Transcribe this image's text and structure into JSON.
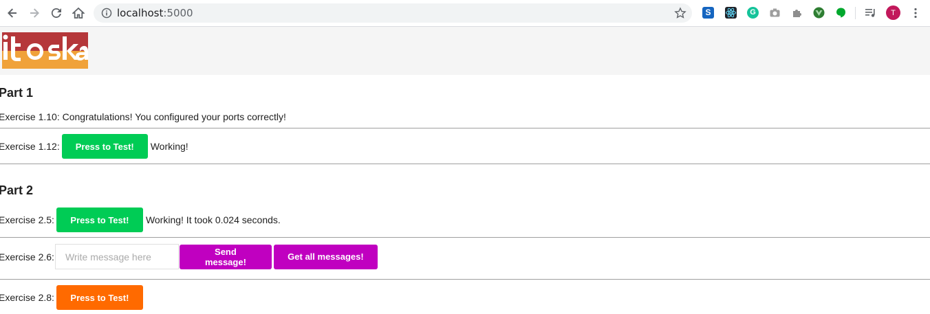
{
  "browser": {
    "url_host": "localhost",
    "url_port": ":5000",
    "avatar_letter": "T"
  },
  "logo": {
    "text": "toska",
    "colors": {
      "top": "#b5373a",
      "bottom": "#f0a23a"
    }
  },
  "part1": {
    "heading": "Part 1",
    "ex110": {
      "text": "Exercise 1.10: Congratulations! You configured your ports correctly!"
    },
    "ex112": {
      "label": "Exercise 1.12:",
      "button": "Press to Test!",
      "status": "Working!"
    }
  },
  "part2": {
    "heading": "Part 2",
    "ex25": {
      "label": "Exercise 2.5:",
      "button": "Press to Test!",
      "status": "Working! It took 0.024 seconds."
    },
    "ex26": {
      "label": "Exercise 2.6:",
      "placeholder": "Write message here",
      "send": "Send message!",
      "get_all": "Get all messages!"
    },
    "ex28": {
      "label": "Exercise 2.8:",
      "button": "Press to Test!"
    }
  },
  "colors": {
    "green": "#00cc55",
    "magenta": "#c000c0",
    "orange": "#ff6a00"
  }
}
